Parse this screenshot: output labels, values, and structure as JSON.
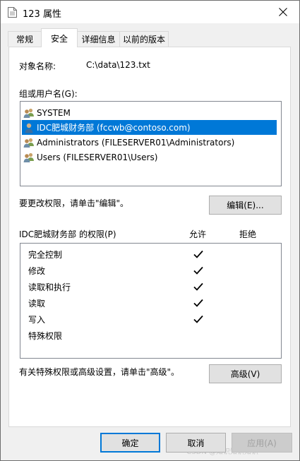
{
  "window": {
    "title": "123 属性"
  },
  "tabs": [
    {
      "label": "常规",
      "active": false
    },
    {
      "label": "安全",
      "active": true
    },
    {
      "label": "详细信息",
      "active": false
    },
    {
      "label": "以前的版本",
      "active": false
    }
  ],
  "object": {
    "label": "对象名称:",
    "value": "C:\\data\\123.txt"
  },
  "groups": {
    "label": "组或用户名(G):",
    "items": [
      {
        "label": "SYSTEM",
        "icon": "users-group-icon",
        "selected": false
      },
      {
        "label": "IDC肥城财务部 (fccwb@contoso.com)",
        "icon": "user-icon",
        "selected": true
      },
      {
        "label": "Administrators (FILESERVER01\\Administrators)",
        "icon": "users-group-icon",
        "selected": false
      },
      {
        "label": "Users (FILESERVER01\\Users)",
        "icon": "users-group-icon",
        "selected": false
      }
    ]
  },
  "change": {
    "hint": "要更改权限，请单击\"编辑\"。",
    "edit_button": "编辑(E)..."
  },
  "permissions": {
    "title": "IDC肥城财务部 的权限(P)",
    "allow_header": "允许",
    "deny_header": "拒绝",
    "rows": [
      {
        "name": "完全控制",
        "allow": true,
        "deny": false
      },
      {
        "name": "修改",
        "allow": true,
        "deny": false
      },
      {
        "name": "读取和执行",
        "allow": true,
        "deny": false
      },
      {
        "name": "读取",
        "allow": true,
        "deny": false
      },
      {
        "name": "写入",
        "allow": true,
        "deny": false
      },
      {
        "name": "特殊权限",
        "allow": false,
        "deny": false
      }
    ]
  },
  "advanced": {
    "hint": "有关特殊权限或高级设置，请单击\"高级\"。",
    "button": "高级(V)"
  },
  "footer": {
    "ok": "确定",
    "cancel": "取消",
    "apply": "应用(A)",
    "watermark": "CSDN @知识知识知识"
  },
  "colors": {
    "selection": "#0078d7",
    "default_button_border": "#0078d7"
  }
}
